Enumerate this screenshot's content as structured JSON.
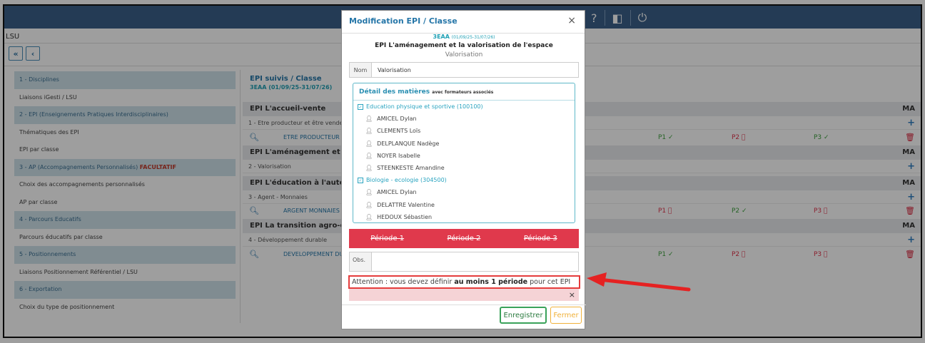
{
  "app": {
    "section": "LSU",
    "nav": {
      "first": "«",
      "prev": "‹"
    },
    "top_icons": [
      "home-icon",
      "gears-icon",
      "school-icon",
      "question-icon",
      "arrows-icon",
      "power-icon"
    ]
  },
  "sidebar": {
    "items": [
      {
        "label": "1 - Disciplines",
        "type": "header"
      },
      {
        "label": "Liaisons iGesti / LSU",
        "type": "item"
      },
      {
        "label": "2 - EPI (Enseignements Pratiques Interdisciplinaires)",
        "type": "header"
      },
      {
        "label": "Thématiques des EPI",
        "type": "item"
      },
      {
        "label": "EPI par classe",
        "type": "item"
      },
      {
        "label": "3 - AP (Accompagnements Personnalisés)",
        "badge": "FACULTATIF",
        "type": "header"
      },
      {
        "label": "Choix des accompagnements personnalisés",
        "type": "item"
      },
      {
        "label": "AP par classe",
        "type": "item"
      },
      {
        "label": "4 - Parcours Educatifs",
        "type": "header"
      },
      {
        "label": "Parcours éducatifs par classe",
        "type": "item"
      },
      {
        "label": "5 - Positionnements",
        "type": "header"
      },
      {
        "label": "Liaisons Positionnement Référentiel / LSU",
        "type": "item"
      },
      {
        "label": "6 - Exportation",
        "type": "header"
      },
      {
        "label": "Choix du type de positionnement",
        "type": "item"
      }
    ]
  },
  "main": {
    "title": "EPI suivis / Classe",
    "classe": "3EAA (01/09/25-31/07/26)",
    "col_ma": "MA",
    "sections": [
      {
        "title": "EPI L'accueil-vente",
        "sub": "1 - Etre producteur et être vendeu",
        "detail": "ETRE PRODUCTEUR E",
        "periods": [
          "P1 ✓",
          "P2 ⃠",
          "P3 ✓"
        ]
      },
      {
        "title": "EPI L'aménagement et la",
        "sub": "2 - Valorisation"
      },
      {
        "title": "EPI L'éducation à l'autono",
        "sub": "3 - Agent - Monnaies",
        "detail": "ARGENT MONNAIES",
        "periods": [
          "P1 ⃠",
          "P2 ✓",
          "P3 ⃠"
        ]
      },
      {
        "title": "EPI La transition agro-éco",
        "sub": "4 - Développement durable",
        "detail": "DEVELOPPEMENT DU",
        "periods": [
          "P1 ✓",
          "P2 ⃠",
          "P3 ⃠"
        ]
      }
    ]
  },
  "modal": {
    "title": "Modification EPI / Classe",
    "close": "×",
    "classe": "3EAA",
    "classe_dates": "(01/09/25-31/07/26)",
    "epi": "EPI L'aménagement et la valorisation de l'espace",
    "thematique": "Valorisation",
    "nom_label": "Nom",
    "nom_value": "Valorisation",
    "detail_title": "Détail des matières",
    "detail_note": "avec formateurs associés",
    "subjects": [
      {
        "name": "Education physique et sportive (100100)",
        "teachers": [
          "AMICEL Dylan",
          "CLEMENTS Loïs",
          "DELPLANQUE Nadège",
          "NOYER Isabelle",
          "STEENKESTE Amandine"
        ]
      },
      {
        "name": "Biologie - ecologie (304500)",
        "teachers": [
          "AMICEL Dylan",
          "DELATTRE Valentine",
          "HEDOUX Sébastien"
        ]
      }
    ],
    "periods": [
      "Période 1",
      "Période 2",
      "Période 3"
    ],
    "obs_label": "Obs.",
    "warning_pre": "Attention : vous devez définir ",
    "warning_bold": "au moins 1 période",
    "warning_post": " pour cet EPI",
    "warning_close": "×",
    "btn_save": "Enregistrer",
    "btn_close": "Fermer"
  },
  "colors": {
    "topbar": "#3a5f8a",
    "accent": "#2576a8",
    "danger": "#e0394c",
    "ok": "#3ea13e",
    "annotation_arrow": "#e52222"
  }
}
